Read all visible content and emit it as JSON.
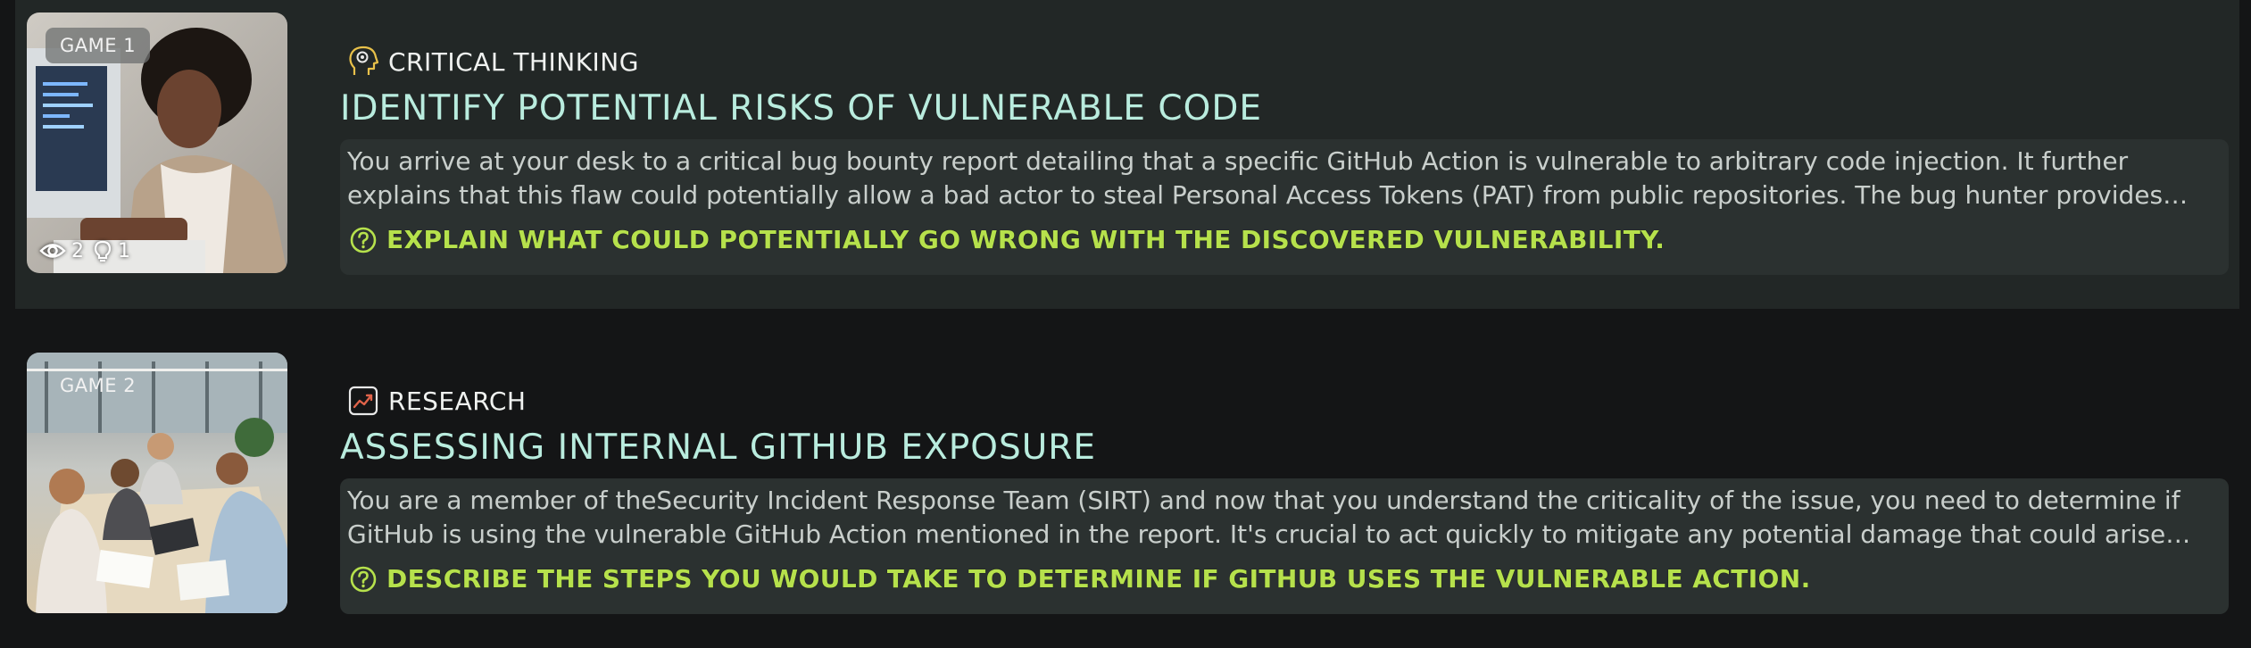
{
  "games": [
    {
      "badge": "GAME 1",
      "stats": {
        "views": "2",
        "hints": "1"
      },
      "category": {
        "label": "CRITICAL THINKING",
        "icon": "head-gear-icon"
      },
      "title": "IDENTIFY POTENTIAL RISKS OF VULNERABLE CODE",
      "description": "You arrive at your desk to a critical bug bounty report detailing that a specific GitHub Action is vulnerable to arbitrary code injection. It further explains that this flaw could potentially allow a bad actor to steal Personal Access Tokens (PAT) from public repositories. The bug hunter provides you with evidence that amplifies the urgency of the situation.",
      "prompt": "EXPLAIN WHAT COULD POTENTIALLY GO WRONG WITH THE DISCOVERED VULNERABILITY."
    },
    {
      "badge": "GAME 2",
      "category": {
        "label": "RESEARCH",
        "icon": "chart-icon"
      },
      "title": "ASSESSING INTERNAL GITHUB EXPOSURE",
      "description": "You are a member of theSecurity Incident Response Team (SIRT) and now that you understand the criticality of the issue, you need to determine if GitHub is using the vulnerable GitHub Action mentioned in the report. It's crucial to act quickly to mitigate any potential damage that could arise from a lapse in this investigation. What steps would you take?",
      "prompt": "DESCRIBE THE STEPS YOU WOULD TAKE TO DETERMINE IF GITHUB USES THE VULNERABLE ACTION."
    }
  ],
  "colors": {
    "title": "#b9ecde",
    "prompt": "#b6e14c",
    "selected_row_bg": "#222726",
    "desc_box_bg": "#2b3130",
    "page_bg": "#141516"
  }
}
